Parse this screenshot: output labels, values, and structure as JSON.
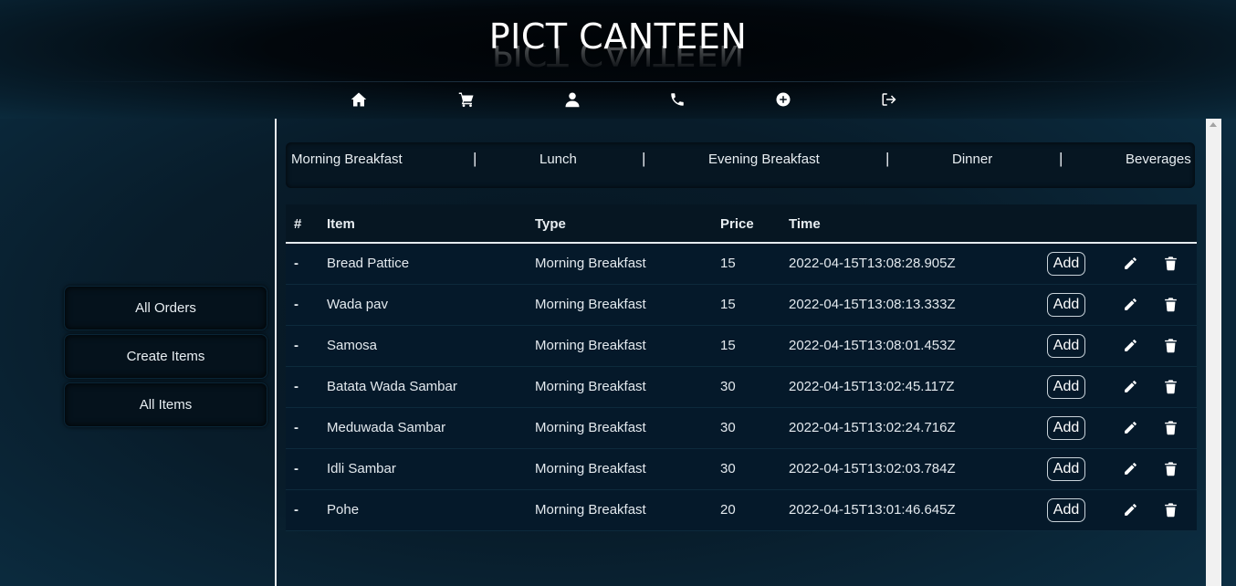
{
  "header": {
    "brand": "PICT CANTEEN",
    "nav": [
      {
        "icon": "home-icon"
      },
      {
        "icon": "cart-icon"
      },
      {
        "icon": "user-icon"
      },
      {
        "icon": "phone-icon"
      },
      {
        "icon": "plus-circle-icon"
      },
      {
        "icon": "sign-out-icon"
      }
    ]
  },
  "sidebar": {
    "items": [
      {
        "label": "All Orders"
      },
      {
        "label": "Create Items"
      },
      {
        "label": "All Items"
      }
    ]
  },
  "categories": {
    "items": [
      "Morning Breakfast",
      "Lunch",
      "Evening Breakfast",
      "Dinner",
      "Beverages"
    ],
    "separator": "|"
  },
  "table": {
    "headers": {
      "index": "#",
      "item": "Item",
      "type": "Type",
      "price": "Price",
      "time": "Time"
    },
    "add_label": "Add",
    "rows": [
      {
        "index": "-",
        "item": "Bread Pattice",
        "type": "Morning Breakfast",
        "price": "15",
        "time": "2022-04-15T13:08:28.905Z"
      },
      {
        "index": "-",
        "item": "Wada pav",
        "type": "Morning Breakfast",
        "price": "15",
        "time": "2022-04-15T13:08:13.333Z"
      },
      {
        "index": "-",
        "item": "Samosa",
        "type": "Morning Breakfast",
        "price": "15",
        "time": "2022-04-15T13:08:01.453Z"
      },
      {
        "index": "-",
        "item": "Batata Wada Sambar",
        "type": "Morning Breakfast",
        "price": "30",
        "time": "2022-04-15T13:02:45.117Z"
      },
      {
        "index": "-",
        "item": "Meduwada Sambar",
        "type": "Morning Breakfast",
        "price": "30",
        "time": "2022-04-15T13:02:24.716Z"
      },
      {
        "index": "-",
        "item": "Idli Sambar",
        "type": "Morning Breakfast",
        "price": "30",
        "time": "2022-04-15T13:02:03.784Z"
      },
      {
        "index": "-",
        "item": "Pohe",
        "type": "Morning Breakfast",
        "price": "20",
        "time": "2022-04-15T13:01:46.645Z"
      }
    ]
  },
  "colors": {
    "background": "#081c2a",
    "header_bg": "#02070c",
    "divider": "#e9eef2",
    "text": "#e8eef2"
  }
}
